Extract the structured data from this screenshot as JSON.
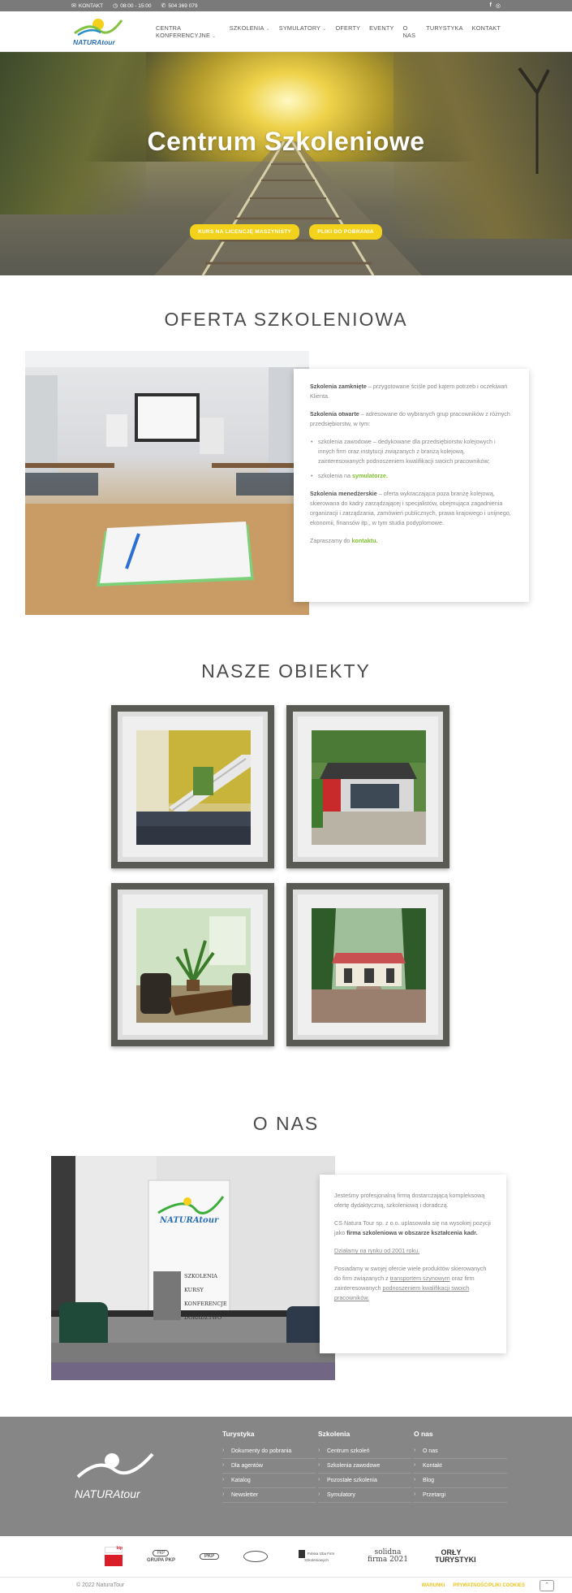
{
  "topbar": {
    "contact": "KONTAKT",
    "hours": "08:00 - 15:00",
    "phone": "504 369 079",
    "social_icons": [
      "facebook-icon",
      "instagram-icon"
    ]
  },
  "header": {
    "logo_text": "NATURAtour",
    "nav": [
      {
        "label": "CENTRA KONFERENCYJNE",
        "dropdown": true
      },
      {
        "label": "SZKOLENIA",
        "dropdown": true
      },
      {
        "label": "SYMULATORY",
        "dropdown": true
      },
      {
        "label": "OFERTY",
        "dropdown": false
      },
      {
        "label": "EVENTY",
        "dropdown": false
      },
      {
        "label": "O NAS",
        "dropdown": false
      },
      {
        "label": "TURYSTYKA",
        "dropdown": false
      },
      {
        "label": "KONTAKT",
        "dropdown": false
      }
    ]
  },
  "hero": {
    "title": "Centrum Szkoleniowe",
    "button1": "KURS NA LICENCJĘ MASZYNISTY",
    "button2": "PLIKI DO POBRANIA"
  },
  "offer": {
    "title": "OFERTA SZKOLENIOWA",
    "p1_bold": "Szkolenia zamknięte",
    "p1": " – przygotowane ściśle pod kątem potrzeb i oczekiwań Klienta.",
    "p2_bold": "Szkolenia otwarte",
    "p2": " – adresowane do wybranych grup pracowników z różnych przedsiębiorstw, w tym:",
    "li1": "szkolenia zawodowe – dedykowane dla przedsiębiorstw kolejowych i innych firm oraz instytucji związanych z branżą kolejową, zainteresowanych podnoszeniem kwalifikacji swoich pracowników;",
    "li2_pre": "szkolenia na ",
    "li2_link": "symulatorze.",
    "p3_bold": "Szkolenia menedżerskie",
    "p3": " – oferta wykraczająca poza branżę kolejową, skierowana do kadry zarządzającej i specjalistów, obejmująca zagadnienia organizacji i zarządzania, zamówień publicznych, prawa krajowego i unijnego, ekonomii, finansów itp., w tym studia podyplomowe.",
    "p4_pre": "Zapraszamy do ",
    "p4_link": "kontaktu."
  },
  "objects": {
    "title": "NASZE OBIEKTY"
  },
  "about": {
    "title": "O NAS",
    "p1": "Jesteśmy profesjonalną firmą dostarczającą kompleksową ofertę dydaktyczną, szkoleniową i doradczą.",
    "p2_pre": "CS Natura Tour sp. z o.o. uplasowała się na wysokiej pozycji jako ",
    "p2_bold": "firma szkoleniowa w obszarze kształcenia kadr.",
    "p3": "Działamy na rynku od 2001 roku.",
    "p4_pre": "Posiadamy w swojej ofercie wiele produktów skierowanych do firm związanych z ",
    "p4_u1": "transportem szynowym",
    "p4_mid": " oraz firm zainteresowanych ",
    "p4_u2": "podnoszeniem kwalifikacji swoich pracowników.",
    "banner_brand": "NATURAtour",
    "banner_items": [
      "SZKOLENIA",
      "KURSY",
      "KONFERENCJE",
      "DORADZTWO"
    ]
  },
  "footer": {
    "logo_text": "NATURAtour",
    "col1": {
      "title": "Turystyka",
      "links": [
        "Dokumenty do pobrania",
        "Dla agentów",
        "Katalog",
        "Newsletter"
      ]
    },
    "col2": {
      "title": "Szkolenia",
      "links": [
        "Centrum szkoleń",
        "Szkolenia zawodowe",
        "Pozostałe szkolenia",
        "Symulatory"
      ]
    },
    "col3": {
      "title": "O nas",
      "links": [
        "O nas",
        "Kontakt",
        "Blog",
        "Przetargi"
      ]
    }
  },
  "partners": [
    "bip",
    "GRUPA PKP",
    "PKP",
    "logo-4",
    "Polska Izba Firm Szkoleniowych",
    "solidna firma 2021",
    "ORŁY TURYSTYKI"
  ],
  "bottom": {
    "copyright": "© 2022 NaturaTour",
    "links": [
      "WARUNKI",
      "PRYWATNOŚĆ/PLIKI COOKIES"
    ]
  },
  "colors": {
    "accent_yellow": "#f2d21b",
    "accent_green": "#7fbf2c",
    "footer_gray": "#868686"
  }
}
